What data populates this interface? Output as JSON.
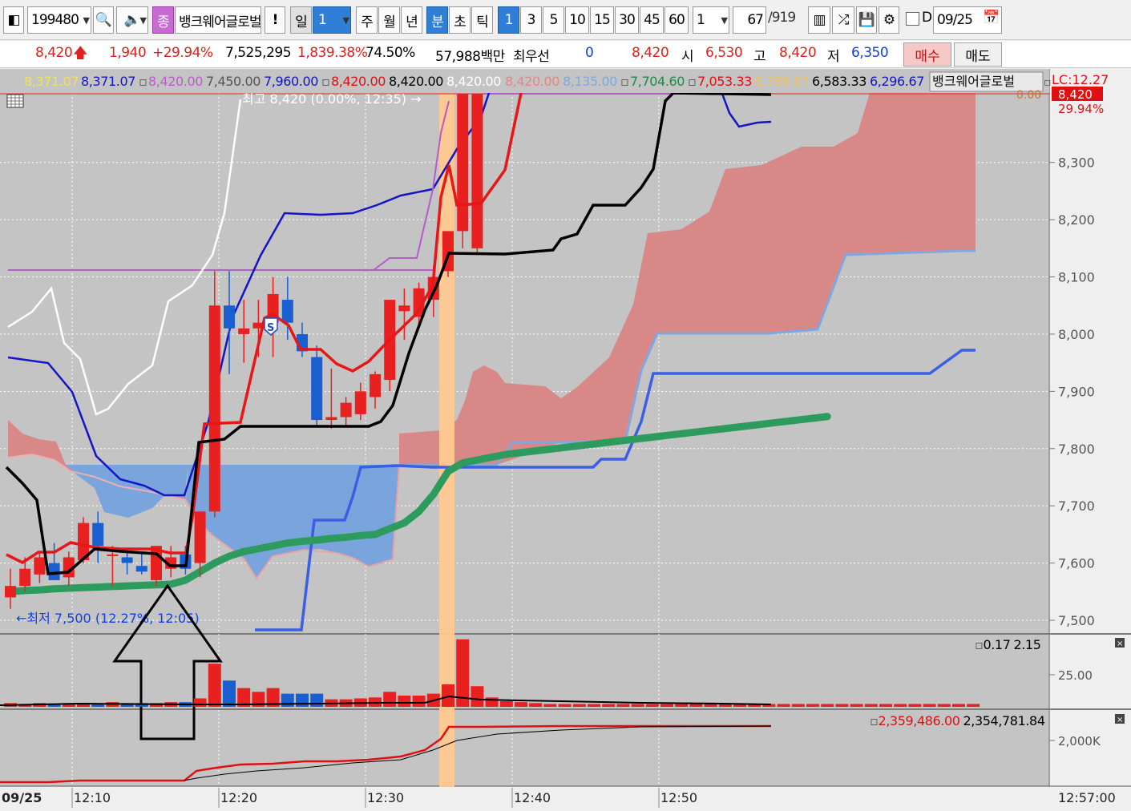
{
  "toolbar": {
    "code": "199480",
    "jong_label": "종",
    "stock_name": "뱅크웨어글로벌",
    "exclaim_label": "!",
    "period_tabs": [
      "일",
      "1",
      "주",
      "월",
      "년",
      "분",
      "초",
      "틱"
    ],
    "minute_options": [
      "1",
      "3",
      "5",
      "10",
      "15",
      "30",
      "45",
      "60"
    ],
    "multiplier": "1",
    "count_value": "67",
    "count_total": "/919",
    "d_label": "D",
    "date_value": "09/25"
  },
  "quote": {
    "price": "8,420",
    "price_arrow": "🡅",
    "change": "1,940",
    "change_pct": "+29.94%",
    "volume": "7,525,295",
    "volume_ratio": "1,839.38%",
    "turnover_ratio": "74.50%",
    "amount": "57,988백만",
    "best_label": "최우선",
    "best_ask": "0",
    "best_bid": "8,420",
    "open_label": "시",
    "open": "6,530",
    "high_label": "고",
    "high": "8,420",
    "low_label": "저",
    "low": "6,350",
    "buy_label": "매수",
    "sell_label": "매도"
  },
  "legend": {
    "v1": "8,371.07",
    "v2": "8,371.07",
    "v3": "8,420.00",
    "v4": "7,450.00",
    "v5": "7,960.00",
    "v6": "8,420.00",
    "v7": "8,420.00",
    "v8": "8,420.00",
    "v9": "8,420.00",
    "v10": "8,135.00",
    "v11": "7,704.60",
    "v12": "7,053.33",
    "v13": "6,788.67",
    "v14": "6,583.33",
    "v15": "6,296.67",
    "name": "뱅크웨어글로벌",
    "lc": "LC:12.27",
    "cur_price": "8,420",
    "cur_pct": "29.94%",
    "zero": "0.00"
  },
  "annotations": {
    "high_note": "최고 8,420 (0.00%, 12:35) →",
    "low_note": "←최저 7,500 (12.27%, 12:05)",
    "signal": "S"
  },
  "volume_panel": {
    "legend_a": "0.17",
    "legend_b": "2.15",
    "tick": "25.00"
  },
  "obv_panel": {
    "legend_a": "2,359,486.00",
    "legend_b": "2,354,781.84",
    "tick": "2,000K"
  },
  "time_axis": {
    "date": "09/25",
    "labels": [
      "12:10",
      "12:20",
      "12:30",
      "12:40",
      "12:50"
    ],
    "current_time": "12:57:00"
  },
  "colors": {
    "up": "#e82020",
    "down": "#1a5fd0",
    "cloud_bull": "#d98888",
    "cloud_bear": "#7aa4dc",
    "highlight": "#ffc890",
    "ma_green": "#2e9b5e"
  },
  "chart_data": {
    "type": "candlestick",
    "price_axis": {
      "ticks": [
        7500,
        7600,
        7700,
        7800,
        7900,
        8000,
        8100,
        8200,
        8300
      ],
      "range": [
        7475,
        8465
      ]
    },
    "candles": [
      {
        "o": 7540,
        "h": 7590,
        "l": 7520,
        "c": 7560
      },
      {
        "o": 7560,
        "h": 7610,
        "l": 7550,
        "c": 7590
      },
      {
        "o": 7580,
        "h": 7620,
        "l": 7565,
        "c": 7610
      },
      {
        "o": 7600,
        "h": 7635,
        "l": 7570,
        "c": 7570
      },
      {
        "o": 7575,
        "h": 7620,
        "l": 7560,
        "c": 7610
      },
      {
        "o": 7605,
        "h": 7680,
        "l": 7600,
        "c": 7670
      },
      {
        "o": 7670,
        "h": 7690,
        "l": 7600,
        "c": 7630
      },
      {
        "o": 7615,
        "h": 7630,
        "l": 7560,
        "c": 7615
      },
      {
        "o": 7610,
        "h": 7625,
        "l": 7580,
        "c": 7600
      },
      {
        "o": 7595,
        "h": 7620,
        "l": 7580,
        "c": 7585
      },
      {
        "o": 7570,
        "h": 7630,
        "l": 7560,
        "c": 7630
      },
      {
        "o": 7590,
        "h": 7630,
        "l": 7575,
        "c": 7610
      },
      {
        "o": 7615,
        "h": 7630,
        "l": 7580,
        "c": 7590
      },
      {
        "o": 7600,
        "h": 7690,
        "l": 7575,
        "c": 7690
      },
      {
        "o": 7690,
        "h": 8110,
        "l": 7680,
        "c": 8050
      },
      {
        "o": 8050,
        "h": 8110,
        "l": 7930,
        "c": 8010
      },
      {
        "o": 8000,
        "h": 8060,
        "l": 7950,
        "c": 8010
      },
      {
        "o": 8010,
        "h": 8060,
        "l": 7960,
        "c": 8020
      },
      {
        "o": 8020,
        "h": 8100,
        "l": 7960,
        "c": 8070
      },
      {
        "o": 8060,
        "h": 8100,
        "l": 7990,
        "c": 8020
      },
      {
        "o": 8000,
        "h": 8020,
        "l": 7960,
        "c": 7970
      },
      {
        "o": 7960,
        "h": 7980,
        "l": 7840,
        "c": 7850
      },
      {
        "o": 7850,
        "h": 7940,
        "l": 7835,
        "c": 7855
      },
      {
        "o": 7855,
        "h": 7890,
        "l": 7840,
        "c": 7880
      },
      {
        "o": 7860,
        "h": 7915,
        "l": 7850,
        "c": 7900
      },
      {
        "o": 7890,
        "h": 7935,
        "l": 7870,
        "c": 7930
      },
      {
        "o": 7920,
        "h": 8060,
        "l": 7900,
        "c": 8060
      },
      {
        "o": 8040,
        "h": 8080,
        "l": 7990,
        "c": 8050
      },
      {
        "o": 8030,
        "h": 8090,
        "l": 8010,
        "c": 8080
      },
      {
        "o": 8060,
        "h": 8120,
        "l": 8030,
        "c": 8100
      },
      {
        "o": 8110,
        "h": 8180,
        "l": 8100,
        "c": 8180
      },
      {
        "o": 8180,
        "h": 8420,
        "l": 8150,
        "c": 8420
      },
      {
        "o": 8150,
        "h": 8420,
        "l": 8140,
        "c": 8420
      }
    ],
    "volume": [
      4,
      3,
      4,
      3,
      4,
      4,
      3,
      5,
      4,
      4,
      4,
      5,
      5,
      9,
      46,
      28,
      20,
      16,
      20,
      14,
      14,
      14,
      8,
      8,
      9,
      10,
      16,
      12,
      12,
      14,
      24,
      72,
      22,
      10,
      6,
      5,
      4,
      3,
      3,
      3,
      3,
      3,
      3,
      3,
      3,
      3,
      3,
      3,
      3,
      3,
      3,
      3,
      3,
      3,
      3,
      3,
      3,
      3,
      3,
      3,
      3,
      3,
      3,
      3,
      3,
      3,
      3
    ],
    "ma_green": [
      7550,
      7552,
      7553,
      7555,
      7556,
      7557,
      7558,
      7559,
      7560,
      7561,
      7562,
      7563,
      7570,
      7585,
      7600,
      7612,
      7620,
      7625,
      7630,
      7635,
      7638,
      7640,
      7643,
      7645,
      7648,
      7650,
      7660,
      7670,
      7690,
      7720,
      7760,
      7775,
      7780,
      7785,
      7790,
      7793,
      7796,
      7799,
      7802,
      7805,
      7808,
      7811,
      7814,
      7817,
      7820,
      7823,
      7826,
      7829,
      7832,
      7835,
      7838,
      7841,
      7844,
      7847,
      7850,
      7853,
      7856
    ],
    "red_line": [
      7545,
      7560,
      7575,
      7590,
      7600,
      7610,
      7620,
      7615,
      7612,
      7610,
      7605,
      7600,
      7605,
      7630,
      7850,
      7860,
      7880,
      7910,
      7980,
      8040,
      8020,
      7960,
      7900,
      7880,
      7870,
      7880,
      7900,
      7930,
      7970,
      8000,
      8070,
      8200,
      8300,
      8340,
      8380,
      8400,
      8420
    ],
    "black_line": [
      7760,
      7740,
      7720,
      7590,
      7590,
      7610,
      7620,
      7620,
      7615,
      7615,
      7610,
      7600,
      7600,
      7610,
      7800,
      7805,
      7810,
      7820,
      7830,
      7830,
      7830,
      7830,
      7830,
      7830,
      7832,
      7835,
      7840,
      7870,
      7950,
      8030,
      8090,
      8130,
      8130,
      8130,
      8130,
      8140,
      8150,
      8170,
      8210,
      8230,
      8260,
      8290,
      8330,
      8420,
      8420,
      8420,
      8420,
      8420,
      8420,
      8420,
      8420,
      8420,
      8420
    ]
  }
}
